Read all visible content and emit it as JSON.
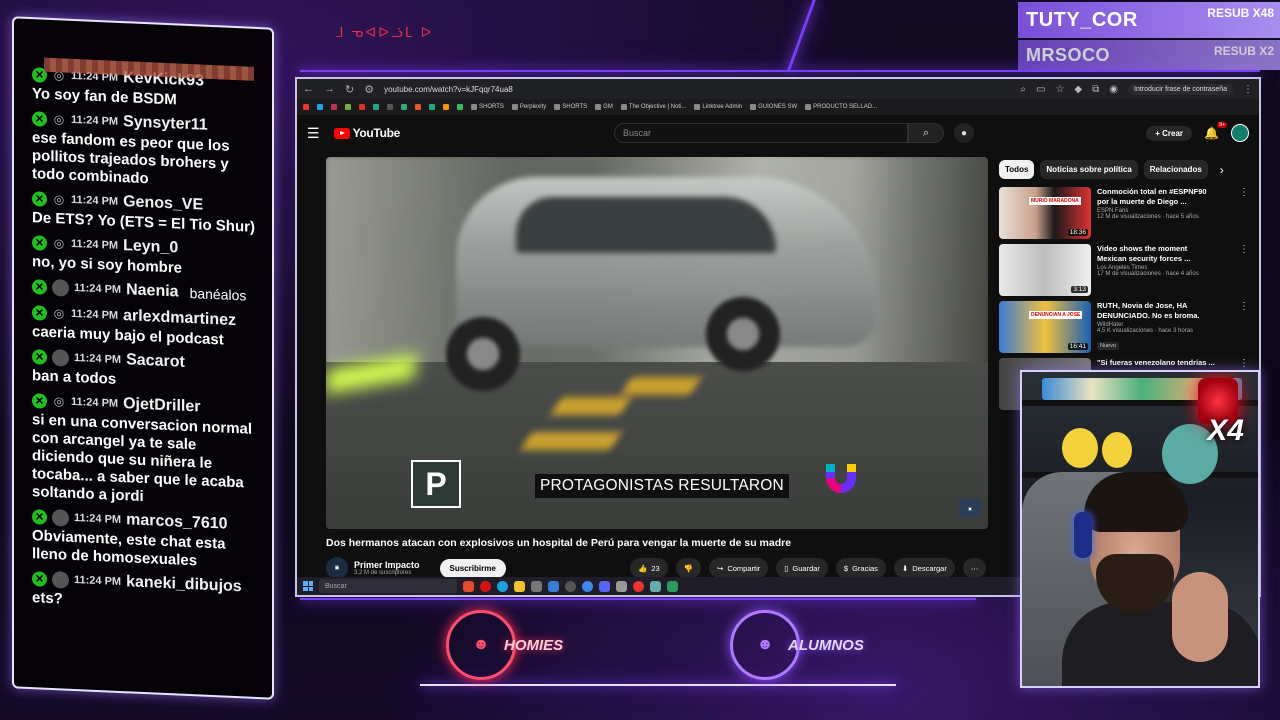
{
  "overlay": {
    "top_note": "ᒧ ᓀᐊᐅᓘᒪ ᐅ",
    "subs": [
      {
        "name": "TUTY_COR",
        "resub": "RESUB X48"
      },
      {
        "name": "MRSOCO",
        "resub": "RESUB X2"
      }
    ],
    "brands": [
      {
        "label": "HOMIES",
        "color": "#ff4d6d"
      },
      {
        "label": "ALUMNOS",
        "color": "#b07bff"
      }
    ],
    "webcam_badge": "X4"
  },
  "chat": {
    "messages": [
      {
        "time": "11:24 PM",
        "user": "KevKick93",
        "extra": "",
        "text": "Yo soy fan de BSDM",
        "avatar": "person"
      },
      {
        "time": "11:24 PM",
        "user": "Synsyter11",
        "extra": "",
        "text": "ese fandom es peor que los pollitos trajeados brohers y todo combinado",
        "avatar": "person"
      },
      {
        "time": "11:24 PM",
        "user": "Genos_VE",
        "extra": "",
        "text": "De ETS? Yo (ETS = El Tio Shur)",
        "avatar": "person"
      },
      {
        "time": "11:24 PM",
        "user": "Leyn_0",
        "extra": "",
        "text": "no, yo si soy hombre",
        "avatar": "person"
      },
      {
        "time": "11:24 PM",
        "user": "Naenia",
        "extra": "banéalos",
        "text": "",
        "avatar": "pic"
      },
      {
        "time": "11:24 PM",
        "user": "arlexdmartinez",
        "extra": "",
        "text": "caeria muy bajo el podcast",
        "avatar": "person"
      },
      {
        "time": "11:24 PM",
        "user": "Sacarot",
        "extra": "",
        "text": "ban a todos",
        "avatar": "pic"
      },
      {
        "time": "11:24 PM",
        "user": "OjetDriller",
        "extra": "",
        "text": "si en una conversacion normal con arcangel ya te sale diciendo que su niñera le tocaba... a saber que le acaba soltando a jordi",
        "avatar": "person"
      },
      {
        "time": "11:24 PM",
        "user": "marcos_7610",
        "extra": "",
        "text": "Obviamente, este chat esta lleno de homosexuales",
        "avatar": "pic"
      },
      {
        "time": "11:24 PM",
        "user": "kaneki_dibujos",
        "extra": "",
        "text": "ets?",
        "avatar": "pic"
      }
    ]
  },
  "browser": {
    "url": "youtube.com/watch?v=kJFqqr74ua8",
    "password_prompt": "Introducir frase de contraseña",
    "bookmarks": [
      "SHORTS",
      "Perplexity",
      "SHORTS",
      "GM",
      "The Objective | Noti...",
      "Linktree Admin",
      "GUIONES SW",
      "PRODUCTO SELLAD..."
    ]
  },
  "youtube": {
    "logo": "YouTube",
    "search_placeholder": "Buscar",
    "create_label": "Crear",
    "notif_count": "9+",
    "video": {
      "subtitle": "PROTAGONISTAS RESULTARON",
      "title": "Dos hermanos atacan con explosivos un hospital de Perú para vengar la muerte de su madre",
      "channel": "Primer Impacto",
      "subscribers": "3,2 M de suscriptores",
      "subscribe_label": "Suscribirme",
      "likes": "23",
      "share_label": "Compartir",
      "save_label": "Guardar",
      "thanks_label": "Gracias",
      "download_label": "Descargar"
    },
    "chips": [
      "Todos",
      "Noticias sobre política",
      "Relacionados"
    ],
    "recommendations": [
      {
        "title": "Conmoción total en #ESPNF90 por la muerte de Diego ...",
        "channel": "ESPN Fans",
        "stats": "12 M de visualizaciones · hace 5 años",
        "duration": "18:36",
        "thumb_text": "MURIÓ MARADONA",
        "badge": ""
      },
      {
        "title": "Video shows the moment Mexican security forces ...",
        "channel": "Los Angeles Times",
        "stats": "17 M de visualizaciones · hace 4 años",
        "duration": "3:13",
        "thumb_text": "",
        "badge": ""
      },
      {
        "title": "RUTH, Novia de Jose, HA DENUNCIADO. No es broma.",
        "channel": "WildHater",
        "stats": "4,5 K visualizaciones · hace 3 horas",
        "duration": "16:41",
        "thumb_text": "DENUNCIAN A JOSE",
        "badge": "Nuevo"
      },
      {
        "title": "\"Si fueras venezolano tendrías ...",
        "channel": "",
        "stats": "",
        "duration": "",
        "thumb_text": "",
        "badge": ""
      }
    ]
  },
  "taskbar": {
    "search_placeholder": "Buscar"
  }
}
